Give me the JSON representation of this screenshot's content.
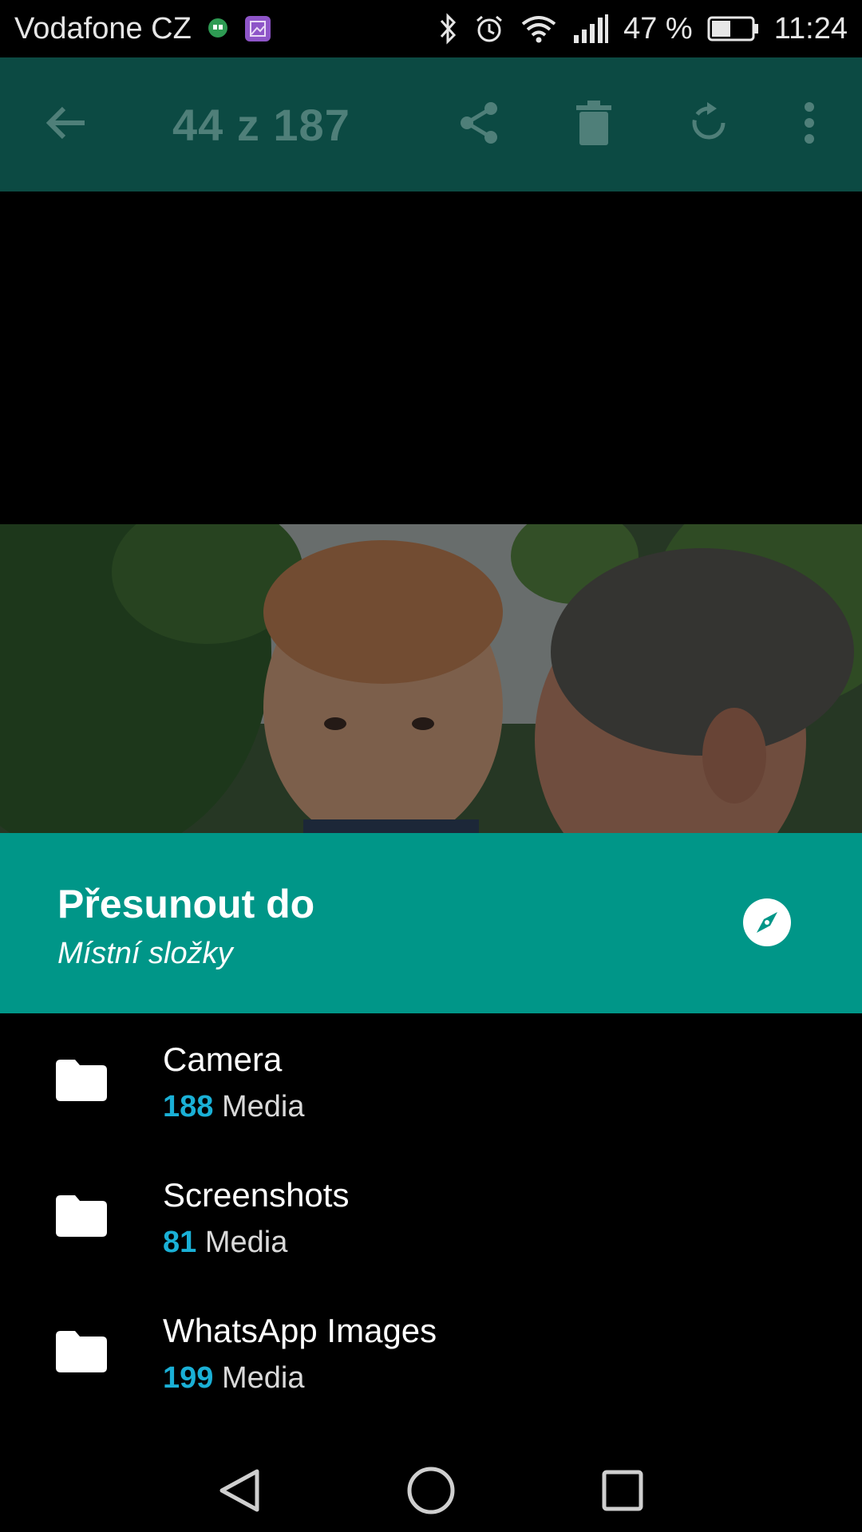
{
  "status_bar": {
    "carrier": "Vodafone CZ",
    "battery_percent": "47 %",
    "time": "11:24",
    "icons": [
      "hangouts-icon",
      "gallery-notification-icon",
      "bluetooth-icon",
      "alarm-icon",
      "wifi-icon",
      "signal-icon",
      "battery-icon"
    ],
    "battery_level": 0.47
  },
  "toolbar": {
    "counter": "44 z 187",
    "icons": [
      "back-arrow-icon",
      "share-icon",
      "delete-icon",
      "rotate-icon",
      "more-vert-icon"
    ],
    "color": "#0c4a43"
  },
  "sheet": {
    "title": "Přesunout do",
    "subtitle": "Místní složky",
    "accent_color": "#009688",
    "explore_icon": "compass-icon"
  },
  "folders": [
    {
      "name": "Camera",
      "count": "188",
      "unit": "Media"
    },
    {
      "name": "Screenshots",
      "count": "81",
      "unit": "Media"
    },
    {
      "name": "WhatsApp Images",
      "count": "199",
      "unit": "Media"
    }
  ],
  "count_color": "#1ab0d6",
  "nav_bar": {
    "icons": [
      "back-triangle-icon",
      "home-circle-icon",
      "recents-square-icon"
    ]
  }
}
